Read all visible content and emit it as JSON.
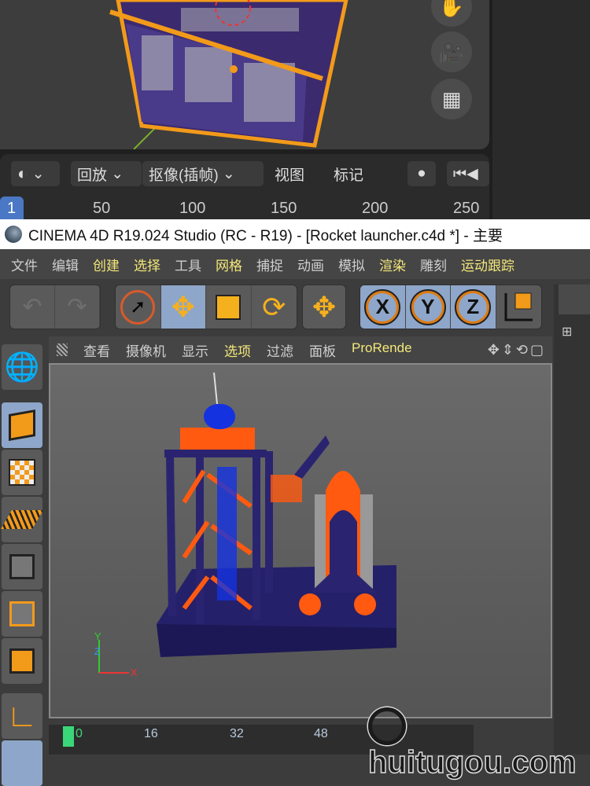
{
  "blender": {
    "header": {
      "editor_icon": "clock-icon",
      "playback": "回放",
      "keying": "抠像(插帧)",
      "view": "视图",
      "marker": "标记"
    },
    "ruler": {
      "current_frame": "1",
      "ticks": [
        "50",
        "100",
        "150",
        "200",
        "250"
      ]
    },
    "nav_icons": [
      "hand-icon",
      "camera-icon",
      "grid-icon"
    ]
  },
  "c4d": {
    "title": "CINEMA 4D R19.024 Studio (RC - R19) - [Rocket launcher.c4d *] - 主要",
    "menu": [
      {
        "label": "文件",
        "hl": false
      },
      {
        "label": "编辑",
        "hl": false
      },
      {
        "label": "创建",
        "hl": true
      },
      {
        "label": "选择",
        "hl": true
      },
      {
        "label": "工具",
        "hl": false
      },
      {
        "label": "网格",
        "hl": true
      },
      {
        "label": "捕捉",
        "hl": false
      },
      {
        "label": "动画",
        "hl": false
      },
      {
        "label": "模拟",
        "hl": false
      },
      {
        "label": "渲染",
        "hl": true
      },
      {
        "label": "雕刻",
        "hl": false
      },
      {
        "label": "运动跟踪",
        "hl": true
      }
    ],
    "axes": [
      "X",
      "Y",
      "Z"
    ],
    "viewport_menu": [
      {
        "label": "查看",
        "hl": false
      },
      {
        "label": "摄像机",
        "hl": false
      },
      {
        "label": "显示",
        "hl": false
      },
      {
        "label": "选项",
        "hl": true
      },
      {
        "label": "过滤",
        "hl": false
      },
      {
        "label": "面板",
        "hl": false
      },
      {
        "label": "ProRende",
        "hl": true
      }
    ],
    "axis_labels": {
      "x": "X",
      "y": "Y",
      "z": "Z"
    },
    "timeline": {
      "ticks": [
        "0",
        "16",
        "32",
        "48"
      ]
    }
  },
  "watermark": "huitugou.com",
  "colors": {
    "accent": "#f29a1a",
    "select": "#8ea6c9",
    "frame": "#3ad67a"
  }
}
